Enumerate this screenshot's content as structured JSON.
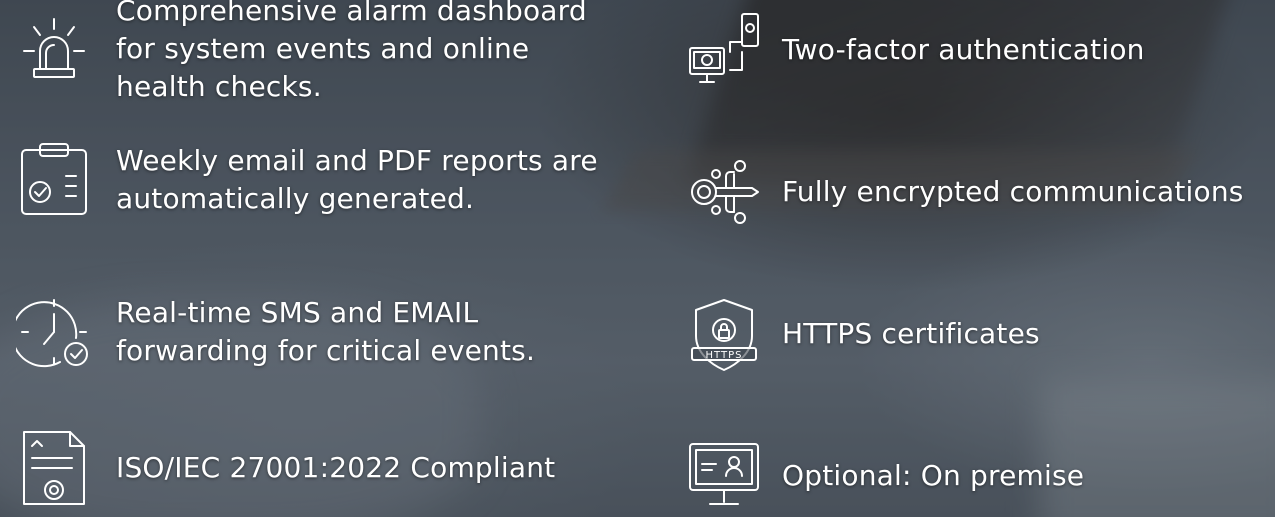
{
  "features_left": [
    {
      "label": "Comprehensive alarm dashboard\nfor system events and online\nhealth checks.",
      "icon": "alarm-light-icon"
    },
    {
      "label": "Weekly email and PDF reports are\nautomatically generated.",
      "icon": "clipboard-report-icon"
    },
    {
      "label": "Real-time SMS and EMAIL\nforwarding for critical events.",
      "icon": "clock-check-icon"
    },
    {
      "label": "ISO/IEC 27001:2022 Compliant",
      "icon": "certificate-icon"
    }
  ],
  "features_right": [
    {
      "label": "Two-factor authentication",
      "icon": "two-factor-devices-icon"
    },
    {
      "label": "Fully encrypted communications",
      "icon": "encrypted-key-icon"
    },
    {
      "label": "HTTPS certificates",
      "icon": "https-shield-icon",
      "badge": "HTTPS"
    },
    {
      "label": "Optional: On premise",
      "icon": "monitor-user-icon"
    }
  ]
}
